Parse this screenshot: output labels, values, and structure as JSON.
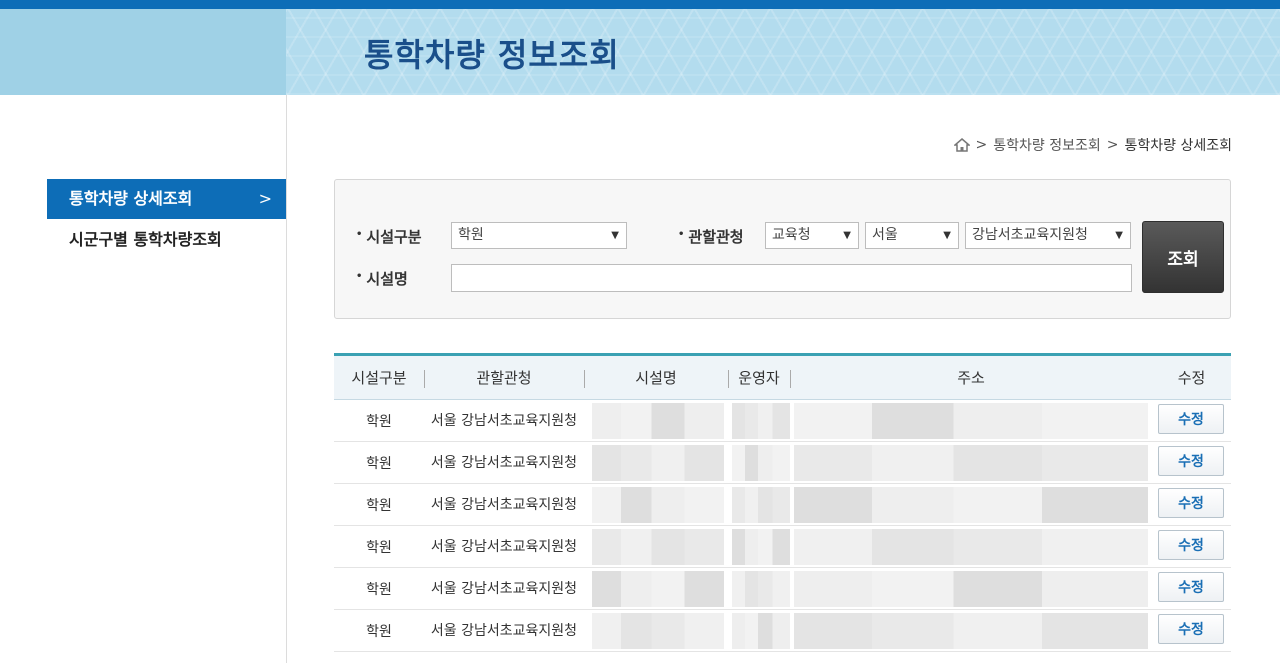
{
  "header": {
    "title": "통학차량 정보조회"
  },
  "sidebar": {
    "items": [
      {
        "label": "통학차량 상세조회",
        "active": true,
        "chevron": ">"
      },
      {
        "label": "시군구별 통학차량조회",
        "active": false
      }
    ]
  },
  "breadcrumb": {
    "separator": ">",
    "items": [
      "통학차량 정보조회",
      "통학차량 상세조회"
    ]
  },
  "search": {
    "facility_type_label": "시설구분",
    "facility_type_value": "학원",
    "agency_label": "관할관청",
    "agency_type_value": "교육청",
    "region_value": "서울",
    "office_value": "강남서초교육지원청",
    "facility_name_label": "시설명",
    "facility_name_value": "",
    "submit_label": "조회",
    "bullet": "•",
    "arrow": "▼"
  },
  "table": {
    "columns": [
      "시설구분",
      "관할관청",
      "시설명",
      "운영자",
      "주소",
      "수정"
    ],
    "rows": [
      {
        "type": "학원",
        "agency": "서울 강남서초교육지원청",
        "name": "",
        "operator": "",
        "address": "",
        "edit": "수정"
      },
      {
        "type": "학원",
        "agency": "서울 강남서초교육지원청",
        "name": "",
        "operator": "",
        "address": "",
        "edit": "수정"
      },
      {
        "type": "학원",
        "agency": "서울 강남서초교육지원청",
        "name": "",
        "operator": "",
        "address": "",
        "edit": "수정"
      },
      {
        "type": "학원",
        "agency": "서울 강남서초교육지원청",
        "name": "",
        "operator": "",
        "address": "",
        "edit": "수정"
      },
      {
        "type": "학원",
        "agency": "서울 강남서초교육지원청",
        "name": "",
        "operator": "",
        "address": "",
        "edit": "수정"
      },
      {
        "type": "학원",
        "agency": "서울 강남서초교육지원청",
        "name": "",
        "operator": "",
        "address": "",
        "edit": "수정"
      }
    ]
  },
  "colors": {
    "brand_blue": "#0d6db7",
    "title_blue": "#1a4f8a",
    "table_accent": "#3aa1b3",
    "edit_text": "#1a6fb5"
  }
}
